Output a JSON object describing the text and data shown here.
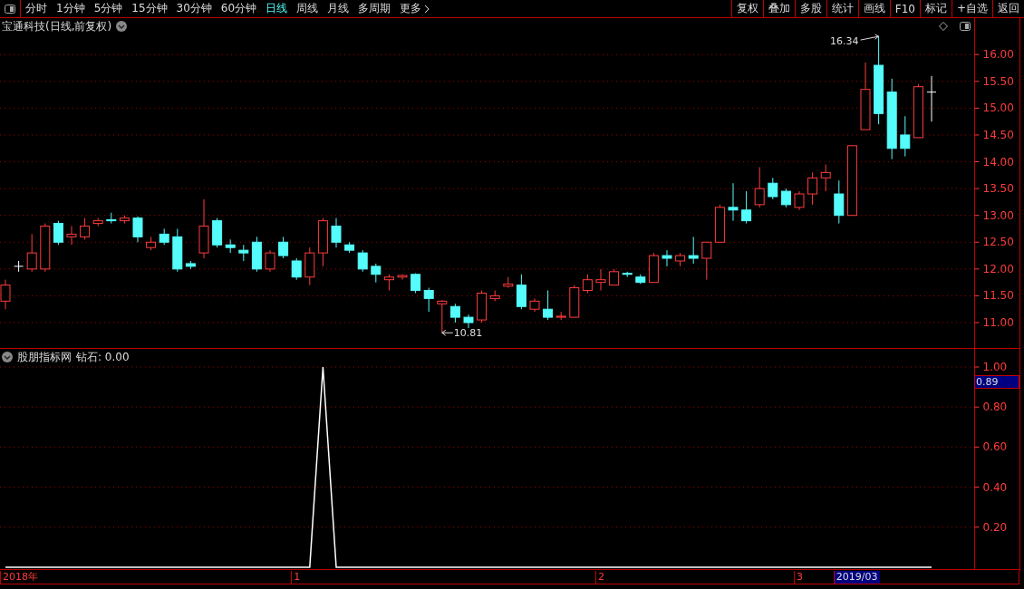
{
  "toolbar": {
    "periods": [
      {
        "label": "分时",
        "selected": false
      },
      {
        "label": "1分钟",
        "selected": false
      },
      {
        "label": "5分钟",
        "selected": false
      },
      {
        "label": "15分钟",
        "selected": false
      },
      {
        "label": "30分钟",
        "selected": false
      },
      {
        "label": "60分钟",
        "selected": false
      },
      {
        "label": "日线",
        "selected": true
      },
      {
        "label": "周线",
        "selected": false
      },
      {
        "label": "月线",
        "selected": false
      },
      {
        "label": "多周期",
        "selected": false
      }
    ],
    "more": "更多",
    "actions": [
      "复权",
      "叠加",
      "多股",
      "统计",
      "画线",
      "F10",
      "标记",
      "+自选",
      "返回"
    ]
  },
  "main_chart": {
    "title": "宝通科技(日线,前复权)",
    "high_label": "16.34",
    "low_label": "10.81",
    "chart_data": {
      "type": "candlestick",
      "grid": true,
      "ylim": [
        10.51,
        16.68
      ],
      "yticks": [
        {
          "value": 16,
          "label": "16.00"
        },
        {
          "value": 15.5,
          "label": "15.50"
        },
        {
          "value": 15,
          "label": "15.00"
        },
        {
          "value": 14.5,
          "label": "14.50"
        },
        {
          "value": 14,
          "label": "14.00"
        },
        {
          "value": 13.5,
          "label": "13.50"
        },
        {
          "value": 13,
          "label": "13.00"
        },
        {
          "value": 12.5,
          "label": "12.50"
        },
        {
          "value": 12,
          "label": "12.00"
        },
        {
          "value": 11.5,
          "label": "11.50"
        },
        {
          "value": 11,
          "label": "11.00"
        }
      ],
      "ohlc": [
        [
          11.4,
          11.8,
          11.25,
          11.7
        ],
        [
          12.05,
          12.15,
          11.95,
          12.05
        ],
        [
          12.0,
          12.65,
          11.95,
          12.3
        ],
        [
          12.0,
          12.85,
          11.95,
          12.8
        ],
        [
          12.85,
          12.9,
          12.45,
          12.5
        ],
        [
          12.6,
          12.8,
          12.45,
          12.65
        ],
        [
          12.6,
          12.95,
          12.55,
          12.8
        ],
        [
          12.85,
          12.95,
          12.8,
          12.9
        ],
        [
          12.92,
          13.05,
          12.85,
          12.9
        ],
        [
          12.9,
          13.0,
          12.85,
          12.95
        ],
        [
          12.95,
          12.98,
          12.5,
          12.6
        ],
        [
          12.4,
          12.6,
          12.35,
          12.5
        ],
        [
          12.65,
          12.75,
          12.45,
          12.5
        ],
        [
          12.6,
          12.75,
          11.95,
          12.0
        ],
        [
          12.1,
          12.15,
          12.0,
          12.05
        ],
        [
          12.3,
          13.3,
          12.2,
          12.8
        ],
        [
          12.9,
          12.95,
          12.4,
          12.45
        ],
        [
          12.45,
          12.55,
          12.3,
          12.4
        ],
        [
          12.35,
          12.45,
          12.15,
          12.3
        ],
        [
          12.5,
          12.6,
          11.95,
          12.0
        ],
        [
          12.0,
          12.35,
          11.95,
          12.3
        ],
        [
          12.5,
          12.6,
          12.2,
          12.25
        ],
        [
          12.15,
          12.2,
          11.8,
          11.85
        ],
        [
          11.85,
          12.4,
          11.7,
          12.3
        ],
        [
          12.3,
          12.95,
          12.05,
          12.9
        ],
        [
          12.8,
          12.95,
          12.4,
          12.5
        ],
        [
          12.45,
          12.5,
          12.3,
          12.35
        ],
        [
          12.3,
          12.35,
          11.95,
          12.0
        ],
        [
          12.05,
          12.1,
          11.75,
          11.9
        ],
        [
          11.8,
          11.9,
          11.6,
          11.85
        ],
        [
          11.85,
          11.9,
          11.8,
          11.88
        ],
        [
          11.9,
          11.92,
          11.55,
          11.6
        ],
        [
          11.6,
          11.65,
          11.2,
          11.45
        ],
        [
          11.35,
          11.42,
          10.81,
          11.4
        ],
        [
          11.3,
          11.35,
          11.0,
          11.1
        ],
        [
          11.1,
          11.15,
          10.9,
          11.0
        ],
        [
          11.05,
          11.6,
          11.0,
          11.55
        ],
        [
          11.45,
          11.6,
          11.4,
          11.5
        ],
        [
          11.68,
          11.85,
          11.65,
          11.72
        ],
        [
          11.7,
          11.9,
          11.25,
          11.3
        ],
        [
          11.25,
          11.45,
          11.2,
          11.4
        ],
        [
          11.25,
          11.6,
          11.05,
          11.1
        ],
        [
          11.1,
          11.2,
          11.05,
          11.12
        ],
        [
          11.1,
          11.7,
          11.1,
          11.65
        ],
        [
          11.6,
          11.9,
          11.55,
          11.8
        ],
        [
          11.75,
          12.0,
          11.6,
          11.8
        ],
        [
          11.7,
          12.0,
          11.7,
          11.95
        ],
        [
          11.92,
          11.95,
          11.85,
          11.9
        ],
        [
          11.85,
          11.9,
          11.72,
          11.75
        ],
        [
          11.75,
          12.3,
          11.75,
          12.25
        ],
        [
          12.25,
          12.35,
          12.05,
          12.2
        ],
        [
          12.15,
          12.3,
          12.05,
          12.25
        ],
        [
          12.25,
          12.6,
          12.1,
          12.2
        ],
        [
          12.2,
          12.5,
          11.8,
          12.5
        ],
        [
          12.5,
          13.2,
          12.5,
          13.15
        ],
        [
          13.15,
          13.6,
          12.9,
          13.1
        ],
        [
          13.1,
          13.45,
          12.85,
          12.9
        ],
        [
          13.2,
          13.9,
          13.15,
          13.5
        ],
        [
          13.6,
          13.7,
          13.3,
          13.35
        ],
        [
          13.45,
          13.5,
          13.15,
          13.2
        ],
        [
          13.15,
          13.45,
          13.1,
          13.4
        ],
        [
          13.4,
          13.8,
          13.2,
          13.7
        ],
        [
          13.7,
          13.95,
          13.45,
          13.8
        ],
        [
          13.4,
          13.65,
          12.85,
          13.0
        ],
        [
          13.0,
          14.3,
          13.0,
          14.3
        ],
        [
          14.6,
          15.85,
          14.6,
          15.35
        ],
        [
          15.8,
          16.34,
          14.7,
          14.9
        ],
        [
          15.3,
          15.55,
          14.05,
          14.25
        ],
        [
          14.5,
          14.85,
          14.1,
          14.25
        ],
        [
          14.45,
          15.45,
          14.45,
          15.4
        ],
        [
          15.3,
          15.6,
          14.75,
          15.3
        ]
      ]
    }
  },
  "indicator": {
    "name": "股朋指标网",
    "reading": "钻石: 0.00",
    "current_value": "0.89",
    "chart_data": {
      "type": "line",
      "grid": true,
      "ylim": [
        -0.014,
        1.095
      ],
      "yticks": [
        {
          "value": 0.2,
          "label": "0.20"
        },
        {
          "value": 0.4,
          "label": "0.40"
        },
        {
          "value": 0.6,
          "label": "0.60"
        },
        {
          "value": 0.8,
          "label": "0.80"
        },
        {
          "value": 1,
          "label": "1.00"
        }
      ],
      "series": [
        {
          "color": "#ffffff",
          "values": [
            0,
            0,
            0,
            0,
            0,
            0,
            0,
            0,
            0,
            0,
            0,
            0,
            0,
            0,
            0,
            0,
            0,
            0,
            0,
            0,
            0,
            0,
            0,
            0,
            1,
            0,
            0,
            0,
            0,
            0,
            0,
            0,
            0,
            0,
            0,
            0,
            0,
            0,
            0,
            0,
            0,
            0,
            0,
            0,
            0,
            0,
            0,
            0,
            0,
            0,
            0,
            0,
            0,
            0,
            0,
            0,
            0,
            0,
            0,
            0,
            0,
            0,
            0,
            0,
            0,
            0,
            0,
            0,
            0,
            0,
            0
          ]
        }
      ]
    }
  },
  "timeline": [
    {
      "label": "2018年",
      "highlighted": false
    },
    {
      "label": "1",
      "highlighted": false
    },
    {
      "label": "2",
      "highlighted": false
    },
    {
      "label": "3",
      "highlighted": false
    },
    {
      "label": "2019/03",
      "highlighted": true
    }
  ]
}
